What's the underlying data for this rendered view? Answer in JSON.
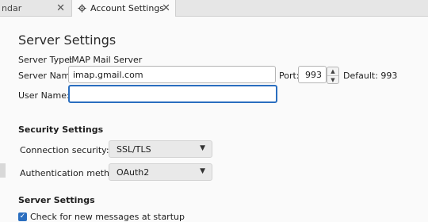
{
  "tabs": [
    {
      "label": "ndar"
    },
    {
      "label": "Account Settings"
    }
  ],
  "server": {
    "heading": "Server Settings",
    "type_label": "Server Type:",
    "type_value": "IMAP Mail Server",
    "name_label": "Server Name:",
    "name_value": "imap.gmail.com",
    "port_label": "Port:",
    "port_value": "993",
    "default_label": "Default: 993",
    "user_label": "User Name:",
    "user_value": ""
  },
  "security": {
    "heading": "Security Settings",
    "conn_label": "Connection security:",
    "conn_value": "SSL/TLS",
    "auth_label": "Authentication method:",
    "auth_value": "OAuth2"
  },
  "server2": {
    "heading": "Server Settings",
    "check_label": "Check for new messages at startup",
    "check_checked": true
  },
  "colors": {
    "accent": "#2a6ebf"
  }
}
